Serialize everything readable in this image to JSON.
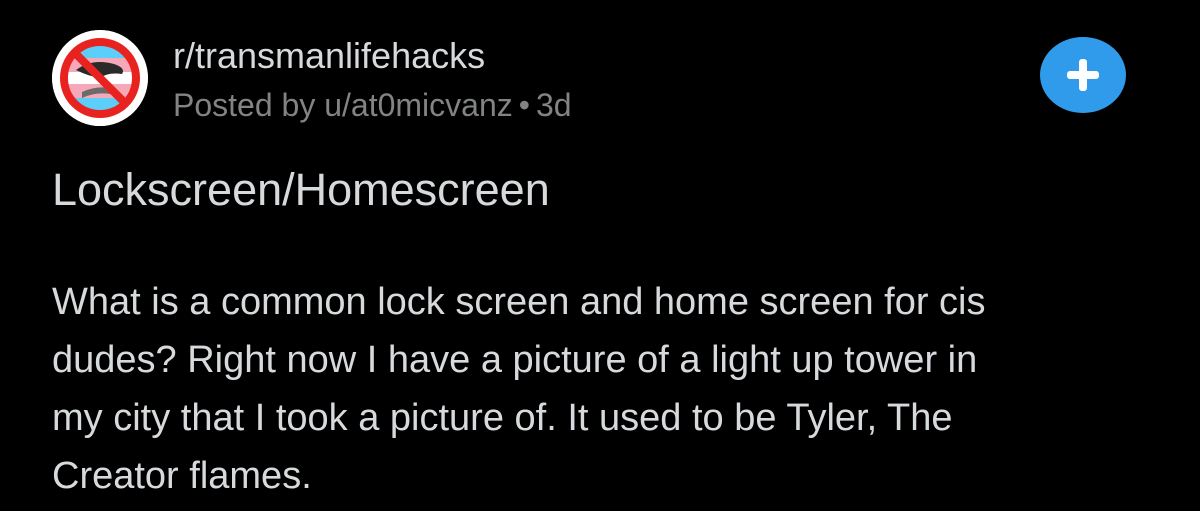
{
  "post": {
    "subreddit": "r/transmanlifehacks",
    "posted_by_prefix": "Posted by",
    "username": "u/at0micvanz",
    "separator": "•",
    "age": "3d",
    "title": "Lockscreen/Homescreen",
    "body_lines": [
      "What is a common lock screen and home screen for cis",
      "dudes? Right now I have a picture of a light up tower in",
      "my city that I took a picture of. It used to be Tyler, The",
      "Creator flames."
    ]
  },
  "icons": {
    "avatar": "subreddit-avatar-no-symbol-trans-flag",
    "join": "plus-icon"
  },
  "colors": {
    "background": "#000000",
    "text_primary": "#d7dadc",
    "text_secondary": "#818384",
    "accent_blue": "#2f9bea",
    "avatar_ring_red": "#e8231f",
    "trans_blue": "#5bcefa",
    "trans_pink": "#f5a9b8"
  }
}
